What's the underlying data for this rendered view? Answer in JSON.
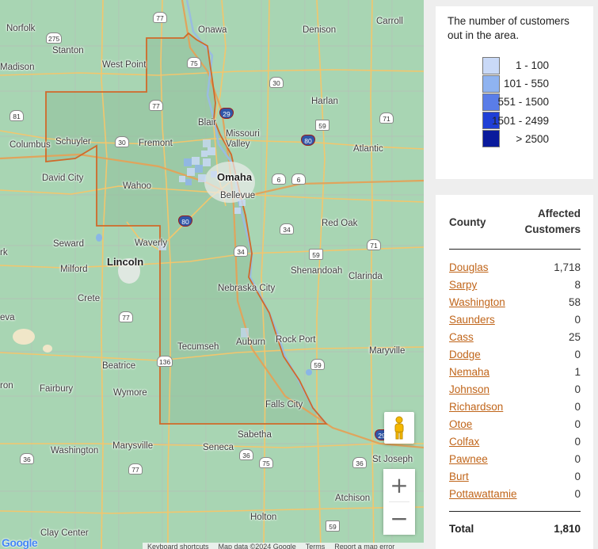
{
  "map": {
    "cities": [
      {
        "name": "Norfolk"
      },
      {
        "name": "Stanton"
      },
      {
        "name": "Madison"
      },
      {
        "name": "West Point"
      },
      {
        "name": "Onawa"
      },
      {
        "name": "Denison"
      },
      {
        "name": "Carroll"
      },
      {
        "name": "Harlan"
      },
      {
        "name": "Blair"
      },
      {
        "name": "Missouri Valley"
      },
      {
        "name": "Columbus"
      },
      {
        "name": "Schuyler"
      },
      {
        "name": "Fremont"
      },
      {
        "name": "Atlantic"
      },
      {
        "name": "David City"
      },
      {
        "name": "Wahoo"
      },
      {
        "name": "Omaha",
        "big": true
      },
      {
        "name": "Bellevue"
      },
      {
        "name": "Red Oak"
      },
      {
        "name": "Seward"
      },
      {
        "name": "Waverly"
      },
      {
        "name": "Lincoln",
        "big": true
      },
      {
        "name": "Milford"
      },
      {
        "name": "Shenandoah"
      },
      {
        "name": "Clarinda"
      },
      {
        "name": "Nebraska City"
      },
      {
        "name": "Crete"
      },
      {
        "name": "Rock Port"
      },
      {
        "name": "Auburn"
      },
      {
        "name": "Tecumseh"
      },
      {
        "name": "Beatrice"
      },
      {
        "name": "Maryville"
      },
      {
        "name": "Fairbury"
      },
      {
        "name": "Wymore"
      },
      {
        "name": "Falls City"
      },
      {
        "name": "Sabetha"
      },
      {
        "name": "Marysville"
      },
      {
        "name": "Seneca"
      },
      {
        "name": "Washington"
      },
      {
        "name": "St Joseph"
      },
      {
        "name": "Atchison"
      },
      {
        "name": "Holton"
      },
      {
        "name": "Clay Center"
      },
      {
        "name": "rk"
      },
      {
        "name": "eva"
      },
      {
        "name": "ron"
      }
    ],
    "shields": [
      {
        "num": "77",
        "type": "us"
      },
      {
        "num": "275",
        "type": "us"
      },
      {
        "num": "75",
        "type": "us"
      },
      {
        "num": "77",
        "type": "us"
      },
      {
        "num": "30",
        "type": "us"
      },
      {
        "num": "81",
        "type": "us"
      },
      {
        "num": "29",
        "type": "i"
      },
      {
        "num": "59",
        "type": "state"
      },
      {
        "num": "71",
        "type": "us"
      },
      {
        "num": "80",
        "type": "i"
      },
      {
        "num": "30",
        "type": "us"
      },
      {
        "num": "6",
        "type": "us"
      },
      {
        "num": "6",
        "type": "us"
      },
      {
        "num": "80",
        "type": "i"
      },
      {
        "num": "34",
        "type": "us"
      },
      {
        "num": "34",
        "type": "us"
      },
      {
        "num": "59",
        "type": "state"
      },
      {
        "num": "71",
        "type": "us"
      },
      {
        "num": "77",
        "type": "us"
      },
      {
        "num": "136",
        "type": "us"
      },
      {
        "num": "59",
        "type": "us"
      },
      {
        "num": "29",
        "type": "i"
      },
      {
        "num": "36",
        "type": "us"
      },
      {
        "num": "77",
        "type": "us"
      },
      {
        "num": "36",
        "type": "us"
      },
      {
        "num": "75",
        "type": "us"
      },
      {
        "num": "36",
        "type": "us"
      },
      {
        "num": "59",
        "type": "state"
      }
    ],
    "zoom_in_label": "+",
    "zoom_out_label": "−",
    "logo": "Google",
    "attribution": [
      "Keyboard shortcuts",
      "Map data ©2024 Google",
      "Terms",
      "Report a map error"
    ]
  },
  "legend": {
    "title": "The number of customers out in the area.",
    "items": [
      {
        "label": "1 - 100",
        "color": "#c9d9f7"
      },
      {
        "label": "101 - 550",
        "color": "#8fb3f0"
      },
      {
        "label": "551 - 1500",
        "color": "#5a7de8"
      },
      {
        "label": "1501 - 2499",
        "color": "#1f3fd6"
      },
      {
        "label": "> 2500",
        "color": "#0a1a9c"
      }
    ]
  },
  "table": {
    "col_county": "County",
    "col_affected": "Affected Customers",
    "rows": [
      {
        "county": "Douglas",
        "count": "1,718"
      },
      {
        "county": "Sarpy",
        "count": "8"
      },
      {
        "county": "Washington",
        "count": "58"
      },
      {
        "county": "Saunders",
        "count": "0"
      },
      {
        "county": "Cass",
        "count": "25"
      },
      {
        "county": "Dodge",
        "count": "0"
      },
      {
        "county": "Nemaha",
        "count": "1"
      },
      {
        "county": "Johnson",
        "count": "0"
      },
      {
        "county": "Richardson",
        "count": "0"
      },
      {
        "county": "Otoe",
        "count": "0"
      },
      {
        "county": "Colfax",
        "count": "0"
      },
      {
        "county": "Pawnee",
        "count": "0"
      },
      {
        "county": "Burt",
        "count": "0"
      },
      {
        "county": "Pottawattamie",
        "count": "0"
      }
    ],
    "total_label": "Total",
    "total_value": "1,810"
  }
}
